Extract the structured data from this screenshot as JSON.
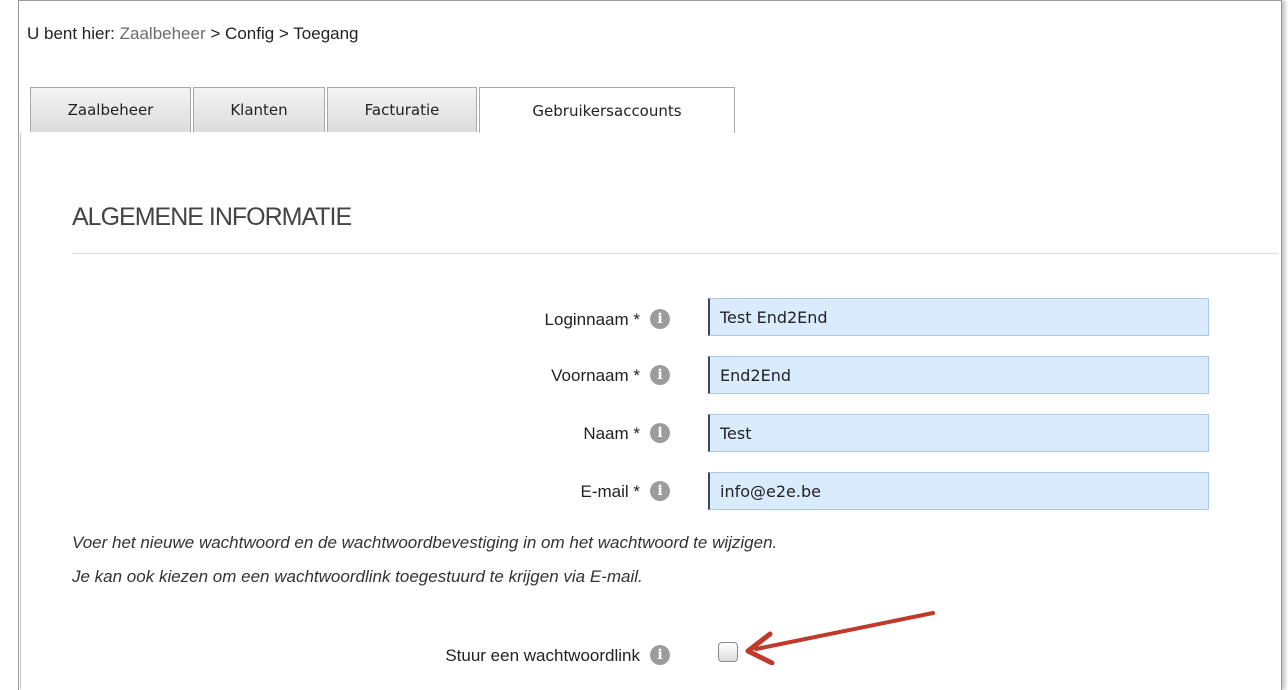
{
  "breadcrumb": {
    "prefix": "U bent hier:",
    "items": [
      "Zaalbeheer",
      "Config",
      "Toegang"
    ],
    "separator": ">"
  },
  "tabs": [
    {
      "label": "Zaalbeheer",
      "active": false
    },
    {
      "label": "Klanten",
      "active": false
    },
    {
      "label": "Facturatie",
      "active": false
    },
    {
      "label": "Gebruikersaccounts",
      "active": true
    }
  ],
  "section": {
    "title": "ALGEMENE INFORMATIE"
  },
  "form": {
    "fields": [
      {
        "label": "Loginnaam *",
        "value": "Test End2End"
      },
      {
        "label": "Voornaam *",
        "value": "End2End"
      },
      {
        "label": "Naam *",
        "value": "Test"
      },
      {
        "label": "E-mail *",
        "value": "info@e2e.be"
      }
    ],
    "notes": [
      "Voer het nieuwe wachtwoord en de wachtwoordbevestiging in om het wachtwoord te wijzigen.",
      "Je kan ook kiezen om een wachtwoordlink toegestuurd te krijgen via E-mail."
    ],
    "send_link": {
      "label": "Stuur een wachtwoordlink",
      "checked": false
    }
  },
  "icons": {
    "info": "info-icon",
    "annotation": "red-arrow-icon"
  },
  "colors": {
    "field_background": "#d9ebfc",
    "annotation_arrow": "#c0392b",
    "info_icon": "#9c9c9c"
  }
}
